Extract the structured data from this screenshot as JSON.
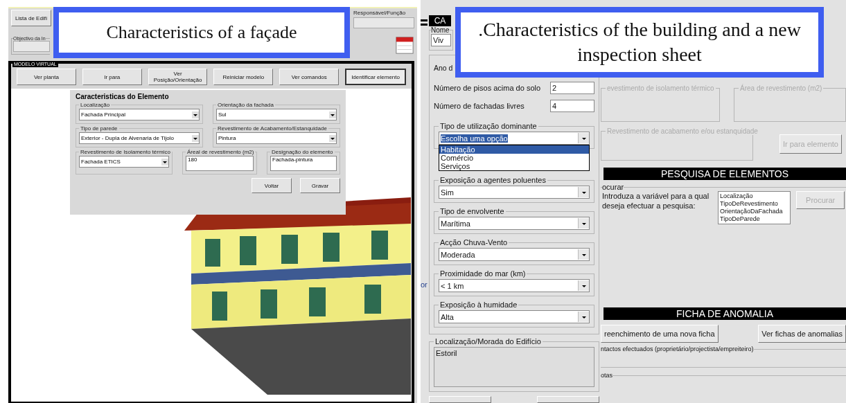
{
  "captions": [
    {
      "text": "Characteristics of a façade"
    },
    {
      "text": ".Characteristics of the building and a new inspection sheet"
    }
  ],
  "left_window": {
    "list_button": "Lista de Edifí",
    "responsible_label": "Responsável/Função",
    "objective_label": "Objectivo da In",
    "model_frame_label": "MODELO VIRTUAL",
    "toolbar": [
      {
        "label": "Ver planta",
        "selected": false
      },
      {
        "label": "Ir para",
        "selected": false
      },
      {
        "label": "Ver Posição/Orientação",
        "selected": false
      },
      {
        "label": "Reiniciar modelo",
        "selected": false
      },
      {
        "label": "Ver comandos",
        "selected": false
      },
      {
        "label": "Identificar elemento",
        "selected": true
      }
    ],
    "dialog": {
      "title": "Caracteristicas do Elemento",
      "rows": [
        [
          {
            "kind": "select",
            "label": "Localização",
            "value": "Fachada Principal"
          },
          {
            "kind": "select",
            "label": "Orientação da fachada",
            "value": "Sul"
          }
        ],
        [
          {
            "kind": "select",
            "label": "Tipo de parede",
            "value": "Exterior - Dupla de Alvenaria de Tijolo"
          },
          {
            "kind": "select",
            "label": "Revestimento de Acabamento/Estanquidade",
            "value": "Pintura"
          }
        ],
        [
          {
            "kind": "select",
            "label": "Revestimento de Isolamento térmico",
            "value": "Fachada ETICS"
          },
          {
            "kind": "text",
            "label": "Áreal de revestimento (m2)",
            "value": "180"
          },
          {
            "kind": "text",
            "label": "Designação do elemento",
            "value": "Fachada-pintura"
          }
        ]
      ],
      "buttons": [
        "Voltar",
        "Gravar"
      ]
    }
  },
  "gap_fragment": "or",
  "right_window": {
    "header": "CA",
    "name_field": {
      "label": "Nome",
      "value": "Viv"
    },
    "year_label": "Ano d",
    "numeric_fields": [
      {
        "label": "Número de pisos acima do solo",
        "value": "2"
      },
      {
        "label": "Número de fachadas livres",
        "value": "4"
      }
    ],
    "selects": [
      {
        "label": "Tipo de utilização dominante",
        "value": "Escolha uma opção",
        "open": true,
        "options": [
          {
            "label": "Habitação",
            "selected": true
          },
          {
            "label": "Comércio",
            "selected": false
          },
          {
            "label": "Serviços",
            "selected": false
          }
        ]
      },
      {
        "label": "Exposição a agentes poluentes",
        "value": "Sim"
      },
      {
        "label": "Tipo de envolvente",
        "value": "Marítima"
      },
      {
        "label": "Acção Chuva-Vento",
        "value": "Moderada"
      },
      {
        "label": "Proximidade do mar (km)",
        "value": "< 1 km"
      },
      {
        "label": "Exposição à humidade",
        "value": "Alta"
      }
    ],
    "address": {
      "label": "Localização/Morada do Edifício",
      "value": "Estoril"
    },
    "disabled_groups": [
      {
        "label": "evestimento de isolamento térmico"
      },
      {
        "label": "Área de revestimento (m2)"
      },
      {
        "label": "Revestimento de acabamento e/ou estanquidade"
      }
    ],
    "goto_button": {
      "label": "Ir para elemento",
      "disabled": true
    },
    "search": {
      "heading": "PESQUISA DE ELEMENTOS",
      "group_label": "ocurar",
      "prompt": "Introduza a variável para a qual deseja efectuar a pesquisa:",
      "options": [
        "Localização",
        "TipoDeRevestimento",
        "OrientaçãoDaFachada",
        "TipoDeParede"
      ],
      "button": {
        "label": "Procurar",
        "disabled": true
      }
    },
    "anomaly": {
      "heading": "FICHA DE ANOMALIA",
      "buttons": [
        "reenchimento de uma nova ficha",
        "Ver fichas de anomalias"
      ],
      "contacts_label": "ntactos efectuados (proprietário/projectista/empreiteiro)",
      "notes_label": "otas"
    }
  }
}
